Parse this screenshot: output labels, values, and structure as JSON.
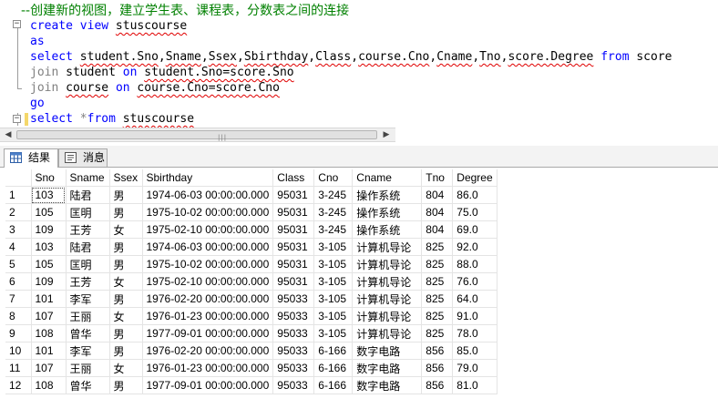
{
  "editor": {
    "comment": "--创建新的视图，建立学生表、课程表，分数表之间的连接",
    "line1_kw": "create view",
    "line1_name": "stuscourse",
    "line2_kw": "as",
    "line3_kw": "select",
    "line3_cols": [
      "student.Sno",
      "Sname",
      "Ssex",
      "Sbirthday",
      "Class",
      "course.Cno",
      "Cname",
      "Tno",
      "score.Degree"
    ],
    "line3_from": "from",
    "line3_table": "score",
    "line4_kw": "join",
    "line4_table": "student",
    "line4_on": "on",
    "line4_cond": "student.Sno=score.Sno",
    "line5_kw": "join",
    "line5_table": "course",
    "line5_on": "on",
    "line5_cond": "course.Cno=score.Cno",
    "line6_kw": "go",
    "line7_kw": "select",
    "line7_star": "*",
    "line7_from": "from",
    "line7_table": "stuscourse"
  },
  "tabs": [
    {
      "label": "结果",
      "icon": "grid-icon",
      "active": true
    },
    {
      "label": "消息",
      "icon": "message-icon",
      "active": false
    }
  ],
  "results": {
    "columns": [
      "",
      "Sno",
      "Sname",
      "Ssex",
      "Sbirthday",
      "Class",
      "Cno",
      "Cname",
      "Tno",
      "Degree"
    ],
    "rows": [
      [
        "1",
        "103",
        "陆君",
        "男",
        "1974-06-03 00:00:00.000",
        "95031",
        "3-245",
        "操作系统",
        "804",
        "86.0"
      ],
      [
        "2",
        "105",
        "匡明",
        "男",
        "1975-10-02 00:00:00.000",
        "95031",
        "3-245",
        "操作系统",
        "804",
        "75.0"
      ],
      [
        "3",
        "109",
        "王芳",
        "女",
        "1975-02-10 00:00:00.000",
        "95031",
        "3-245",
        "操作系统",
        "804",
        "69.0"
      ],
      [
        "4",
        "103",
        "陆君",
        "男",
        "1974-06-03 00:00:00.000",
        "95031",
        "3-105",
        "计算机导论",
        "825",
        "92.0"
      ],
      [
        "5",
        "105",
        "匡明",
        "男",
        "1975-10-02 00:00:00.000",
        "95031",
        "3-105",
        "计算机导论",
        "825",
        "88.0"
      ],
      [
        "6",
        "109",
        "王芳",
        "女",
        "1975-02-10 00:00:00.000",
        "95031",
        "3-105",
        "计算机导论",
        "825",
        "76.0"
      ],
      [
        "7",
        "101",
        "李军",
        "男",
        "1976-02-20 00:00:00.000",
        "95033",
        "3-105",
        "计算机导论",
        "825",
        "64.0"
      ],
      [
        "8",
        "107",
        "王丽",
        "女",
        "1976-01-23 00:00:00.000",
        "95033",
        "3-105",
        "计算机导论",
        "825",
        "91.0"
      ],
      [
        "9",
        "108",
        "曾华",
        "男",
        "1977-09-01 00:00:00.000",
        "95033",
        "3-105",
        "计算机导论",
        "825",
        "78.0"
      ],
      [
        "10",
        "101",
        "李军",
        "男",
        "1976-02-20 00:00:00.000",
        "95033",
        "6-166",
        "数字电路",
        "856",
        "85.0"
      ],
      [
        "11",
        "107",
        "王丽",
        "女",
        "1976-01-23 00:00:00.000",
        "95033",
        "6-166",
        "数字电路",
        "856",
        "79.0"
      ],
      [
        "12",
        "108",
        "曾华",
        "男",
        "1977-09-01 00:00:00.000",
        "95033",
        "6-166",
        "数字电路",
        "856",
        "81.0"
      ]
    ]
  },
  "colors": {
    "keyword": "#0000ff",
    "comment": "#008000",
    "gray": "#808080",
    "squiggle": "#e00000"
  }
}
